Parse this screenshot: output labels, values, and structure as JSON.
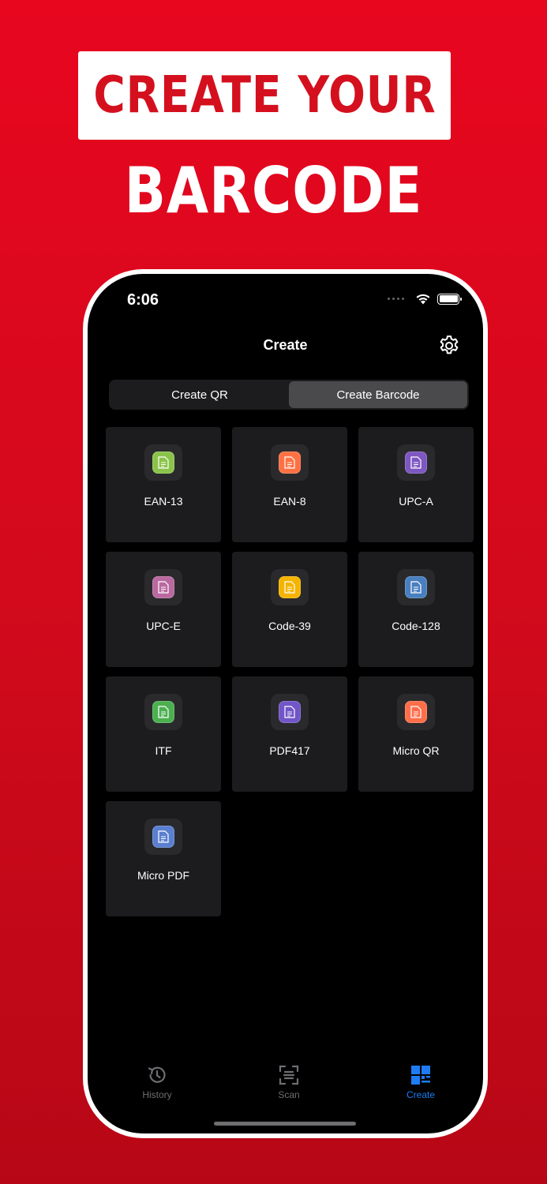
{
  "promo": {
    "headline_top": "CREATE YOUR",
    "headline_bottom": "BARCODE"
  },
  "status_bar": {
    "time": "6:06",
    "icons": [
      "cellular-dots-icon",
      "wifi-icon",
      "battery-icon"
    ]
  },
  "nav": {
    "title": "Create",
    "settings_icon": "gear-icon"
  },
  "segmented": {
    "options": [
      "Create QR",
      "Create Barcode"
    ],
    "selected": "Create Barcode"
  },
  "barcode_types": [
    {
      "label": "EAN-13",
      "color": "#8bc34a"
    },
    {
      "label": "EAN-8",
      "color": "#ff7043"
    },
    {
      "label": "UPC-A",
      "color": "#7e57c2"
    },
    {
      "label": "UPC-E",
      "color": "#ba68a0"
    },
    {
      "label": "Code-39",
      "color": "#f4b400"
    },
    {
      "label": "Code-128",
      "color": "#4a7fbf"
    },
    {
      "label": "ITF",
      "color": "#4caf50"
    },
    {
      "label": "PDF417",
      "color": "#7056c8"
    },
    {
      "label": "Micro QR",
      "color": "#ff6e4a"
    },
    {
      "label": "Micro PDF",
      "color": "#5b7fd0"
    }
  ],
  "tabbar": {
    "items": [
      {
        "label": "History",
        "icon": "history-icon",
        "active": false
      },
      {
        "label": "Scan",
        "icon": "scan-icon",
        "active": false
      },
      {
        "label": "Create",
        "icon": "create-grid-icon",
        "active": true
      }
    ],
    "active_color": "#1e7cf2",
    "inactive_color": "#6e6e73"
  }
}
